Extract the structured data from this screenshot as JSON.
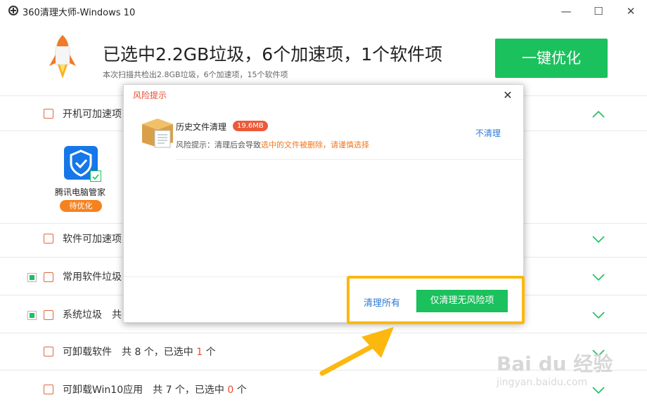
{
  "window": {
    "title": "360清理大师-Windows 10",
    "minimize_glyph": "—",
    "maximize_glyph": "☐",
    "close_glyph": "✕"
  },
  "header": {
    "headline": "已选中2.2GB垃圾，6个加速项，1个软件项",
    "subline": "本次扫描共检出2.8GB垃圾，6个加速项，15个软件项",
    "primary_button": "一键优化",
    "accent_color": "#1bc15d"
  },
  "categories": [
    {
      "label": "开机可加速项",
      "icon": "monitor-icon",
      "expanded": true
    },
    {
      "label": "软件可加速项",
      "icon": "chip-icon",
      "expanded": false
    },
    {
      "label": "常用软件垃圾",
      "icon": "trash-icon",
      "checked": true,
      "expanded": false
    },
    {
      "label": "系统垃圾",
      "suffix": "共",
      "icon": "windows-icon",
      "checked": true,
      "expanded": false
    },
    {
      "label": "可卸载软件",
      "pre": "共 8 个，已选中",
      "count": "1",
      "post": "个",
      "icon": "gift-icon",
      "expanded": false
    },
    {
      "label": "可卸载Win10应用",
      "pre": "共 7 个，已选中",
      "count": "0",
      "post": "个",
      "icon": "package-icon",
      "expanded": false
    }
  ],
  "startup_app": {
    "name": "腾讯电脑管家",
    "status": "待优化",
    "checked": true
  },
  "dialog": {
    "title": "风险提示",
    "close_glyph": "✕",
    "item": {
      "name": "历史文件清理",
      "size": "19.6MB",
      "warn_prefix": "风险提示：清理后会导致",
      "warn_highlight": "选中的文件被删除，请谨慎选择",
      "skip_label": "不清理"
    },
    "clean_all_label": "清理所有",
    "safe_only_label": "仅清理无风险项"
  },
  "annotation": {
    "highlight_color": "#fcb80f"
  },
  "watermark": {
    "brand": "Bai du 经验",
    "url": "jingyan.baidu.com"
  }
}
